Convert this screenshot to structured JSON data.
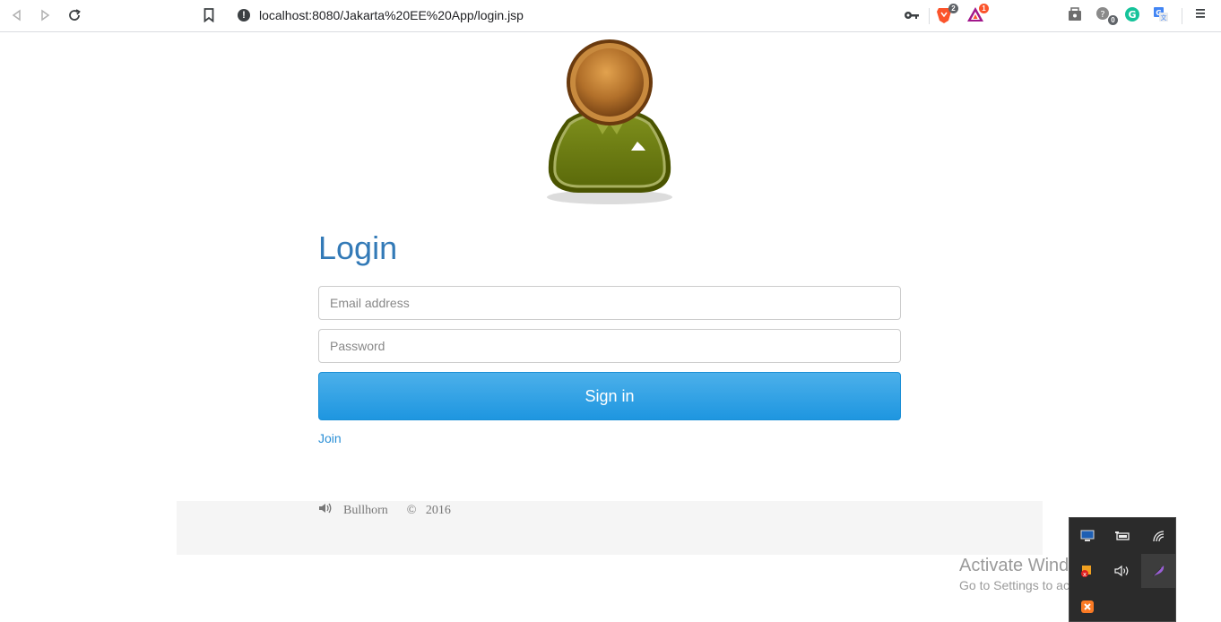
{
  "browser": {
    "url": "localhost:8080/Jakarta%20EE%20App/login.jsp",
    "brave_badge": "2",
    "rewards_badge": "1",
    "ext_badge": "0",
    "buttons": [
      "back",
      "forward",
      "reload",
      "bookmark",
      "menu"
    ]
  },
  "login": {
    "title": "Login",
    "email_placeholder": "Email address",
    "password_placeholder": "Password",
    "signin_label": "Sign in",
    "join_label": "Join"
  },
  "footer": {
    "text": "Bullhorn      ©   2016"
  },
  "windows": {
    "activate_title": "Activate Windows",
    "activate_sub": "Go to Settings to activate Windows."
  },
  "colors": {
    "title": "#337ab7",
    "button": "#1e96e0",
    "link": "#2a8fd6",
    "footer_bg": "#f5f5f5"
  },
  "icons": [
    "back-icon",
    "forward-icon",
    "reload-icon",
    "bookmark-icon",
    "info-icon",
    "key-icon",
    "brave-shield-icon",
    "brave-rewards-icon",
    "wallet-icon",
    "extension-icon",
    "grammarly-icon",
    "translate-icon",
    "menu-icon",
    "speaker-icon",
    "user-avatar-icon"
  ]
}
